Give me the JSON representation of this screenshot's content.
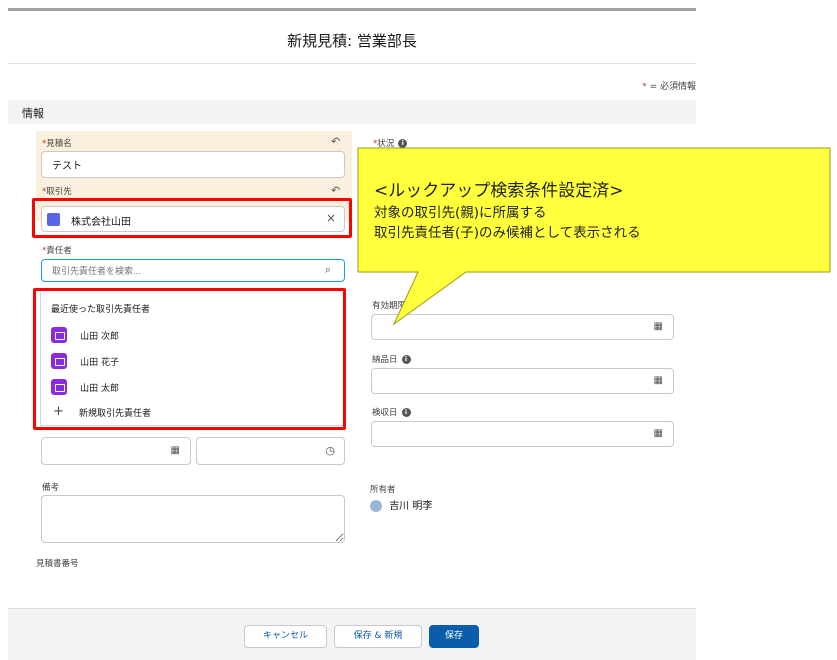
{
  "modal": {
    "title": "新規見積: 営業部長"
  },
  "required_note": {
    "star": "*",
    "text": " = 必須情報"
  },
  "section": {
    "title": "情報"
  },
  "fields": {
    "quote_name": {
      "label": "見積名",
      "value": "テスト"
    },
    "account": {
      "label": "取引先",
      "value": "株式会社山田"
    },
    "contact": {
      "label": "責任者",
      "placeholder": "取引先責任者を検索..."
    },
    "status": {
      "label": "状況"
    },
    "expiry": {
      "label": "有効期限"
    },
    "delivery": {
      "label": "納品日"
    },
    "inspection": {
      "label": "検収日"
    },
    "remarks": {
      "label": "備考"
    },
    "owner": {
      "label": "所有者",
      "value": "吉川 明李"
    },
    "quote_number": {
      "label": "見積書番号"
    }
  },
  "dropdown": {
    "header": "最近使った取引先責任者",
    "items": [
      "山田 次郎",
      "山田 花子",
      "山田 太郎"
    ],
    "new_item": "新規取引先責任者"
  },
  "callout": {
    "line1": "<ルックアップ検索条件設定済>",
    "line2": "対象の取引先(親)に所属する",
    "line3": "取引先責任者(子)のみ候補として表示される",
    "fill": "#ffff3c",
    "stroke": "#9a9a20"
  },
  "footer": {
    "cancel": "キャンセル",
    "save_new": "保存 & 新規",
    "save": "保存"
  },
  "colors": {
    "brand": "#0b5cab",
    "required": "#c23934",
    "highlight": "#ff0000"
  }
}
